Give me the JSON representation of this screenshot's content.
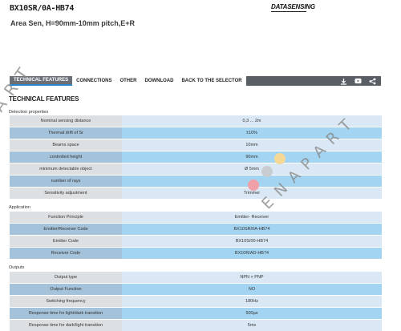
{
  "header": {
    "product_code": "BX10SR/0A-HB74",
    "brand": "DATASENSING",
    "subtitle": "Area Sen, H=90mm-10mm pitch,E+R"
  },
  "nav": {
    "tabs": [
      {
        "label": "TECHNICAL FEATURES",
        "active": true
      },
      {
        "label": "CONNECTIONS",
        "active": false
      },
      {
        "label": "OTHER",
        "active": false
      },
      {
        "label": "DOWNLOAD",
        "active": false
      },
      {
        "label": "BACK TO THE SELECTOR",
        "active": false
      }
    ],
    "icons": [
      "download-icon",
      "youtube-icon",
      "share-icon"
    ]
  },
  "section_title": "TECHNICAL FEATURES",
  "groups": [
    {
      "label": "Detection properties",
      "rows": [
        {
          "label": "Nominal sensing distance",
          "value": "0,3 ... 2m"
        },
        {
          "label": "Thermal drift of Sr",
          "value": "±10%"
        },
        {
          "label": "Beams space",
          "value": "10mm"
        },
        {
          "label": "controlled height",
          "value": "90mm"
        },
        {
          "label": "minimum detectable object",
          "value": "Ø 5mm"
        },
        {
          "label": "number of rays",
          "value": ""
        },
        {
          "label": "Sensitivity adjustment",
          "value": "Trimmer"
        }
      ]
    },
    {
      "label": "Application",
      "rows": [
        {
          "label": "Function Principle",
          "value": "Emitter- Receiver"
        },
        {
          "label": "Emitter/Receiver Code",
          "value": "BX10SR/0A-HB74"
        },
        {
          "label": "Emitter Code",
          "value": "BX10S/00-HB74"
        },
        {
          "label": "Receiver Code",
          "value": "BX10R/AD-HB74"
        }
      ]
    },
    {
      "label": "Outputs",
      "rows": [
        {
          "label": "Output type",
          "value": "NPN + PNP"
        },
        {
          "label": "Output Function",
          "value": "NO"
        },
        {
          "label": "Switching frequency",
          "value": "180Hz"
        },
        {
          "label": "Response time for light/dark transition",
          "value": "500µs"
        },
        {
          "label": "Response time for dark/light transition",
          "value": "5ms"
        }
      ]
    }
  ],
  "watermark": {
    "left_text": "A R T",
    "right_text": "E N A P A R T"
  },
  "colors": {
    "nav_bar": "#5a5f66",
    "nav_active_underline": "#2c84c6",
    "row_label_light": "#dde0e3",
    "row_value_light": "#dae8f5",
    "row_label_dark": "#a4c2d9",
    "row_value_dark": "#a3d4f1",
    "dot_yellow": "#f5d896",
    "dot_gray": "#c8cdd2",
    "dot_red": "#f0a0a8"
  }
}
